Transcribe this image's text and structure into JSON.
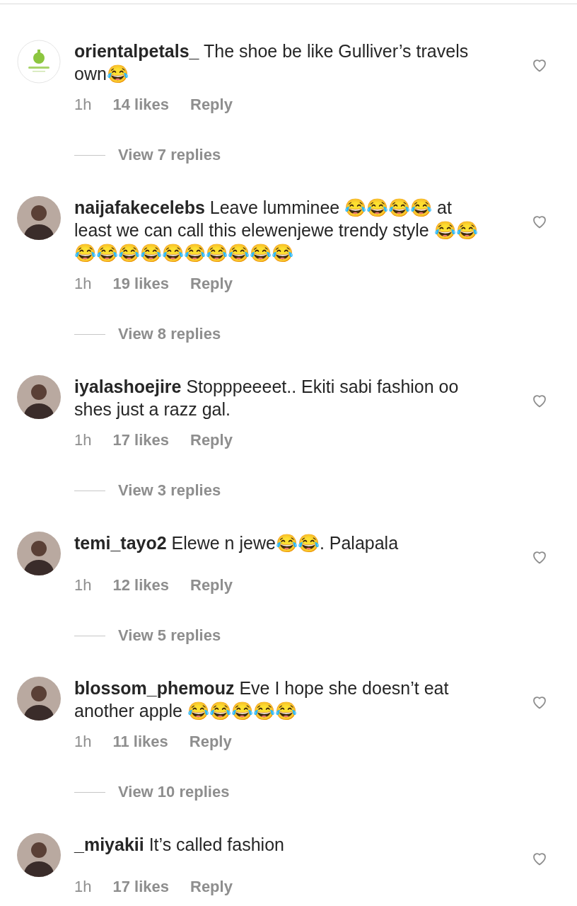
{
  "comments": [
    {
      "avatar": {
        "kind": "logo"
      },
      "username": "orientalpetals_",
      "text": "The shoe be like Gulliver’s travels own😂",
      "time": "1h",
      "likes": "14 likes",
      "reply": "Reply",
      "view_replies": "View 7 replies"
    },
    {
      "avatar": {
        "kind": "photo"
      },
      "username": "naijafakecelebs",
      "text": "Leave lumminee 😂😂😂😂 at least we can call this elewenjewe trendy style 😂😂😂😂😂😂😂😂😂😂😂😂",
      "time": "1h",
      "likes": "19 likes",
      "reply": "Reply",
      "view_replies": "View 8 replies"
    },
    {
      "avatar": {
        "kind": "photo"
      },
      "username": "iyalashoejire",
      "text": "Stopppeeeet.. Ekiti sabi fashion oo shes just a razz gal.",
      "time": "1h",
      "likes": "17 likes",
      "reply": "Reply",
      "view_replies": "View 3 replies"
    },
    {
      "avatar": {
        "kind": "photo"
      },
      "username": "temi_tayo2",
      "text": "Elewe n jewe😂😂. Palapala",
      "time": "1h",
      "likes": "12 likes",
      "reply": "Reply",
      "view_replies": "View 5 replies"
    },
    {
      "avatar": {
        "kind": "photo"
      },
      "username": "blossom_phemouz",
      "text": "Eve I hope she doesn’t eat another apple 😂😂😂😂😂",
      "time": "1h",
      "likes": "11 likes",
      "reply": "Reply",
      "view_replies": "View 10 replies"
    },
    {
      "avatar": {
        "kind": "photo"
      },
      "username": "_miyakii",
      "text": "It’s called fashion",
      "time": "1h",
      "likes": "17 likes",
      "reply": "Reply"
    }
  ]
}
